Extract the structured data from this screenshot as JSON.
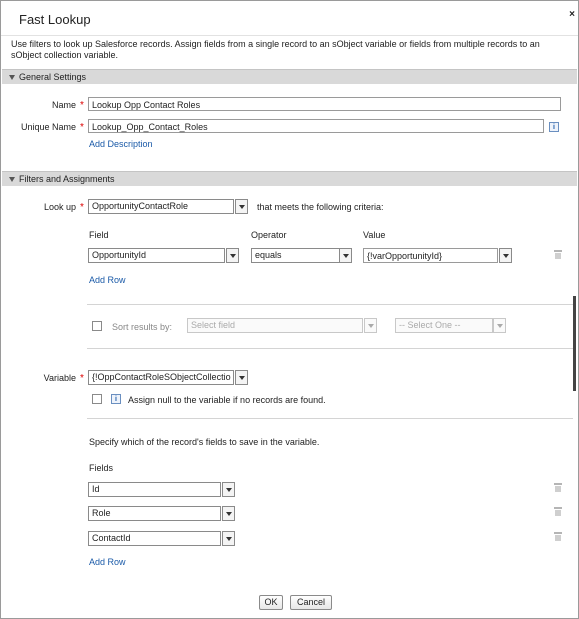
{
  "dialog": {
    "title": "Fast Lookup",
    "close": "×"
  },
  "intro": "Use filters to look up Salesforce records. Assign fields from a single record to an sObject variable or fields from multiple records to an sObject collection variable.",
  "general": {
    "header": "General Settings",
    "name_label": "Name",
    "name_value": "Lookup Opp Contact Roles",
    "unique_label": "Unique Name",
    "unique_value": "Lookup_Opp_Contact_Roles",
    "add_description": "Add Description",
    "required_mark": "*",
    "info_glyph": "i"
  },
  "filters": {
    "header": "Filters and Assignments",
    "lookup_label": "Look up",
    "lookup_value": "OpportunityContactRole",
    "criteria_text": "that meets the following criteria:",
    "col_field": "Field",
    "col_operator": "Operator",
    "col_value": "Value",
    "row_field": "OpportunityId",
    "row_operator": "equals",
    "row_value": "{!varOpportunityId}",
    "add_row": "Add Row",
    "sort_label": "Sort results by:",
    "sort_field_placeholder": "Select field",
    "sort_order_placeholder": "-- Select One --",
    "variable_label": "Variable",
    "variable_value": "{!OppContactRoleSObjectCollectio",
    "assign_null_text": "Assign null to the variable if no records are found.",
    "specify_text": "Specify which of the record's fields to save in the variable.",
    "fields_label": "Fields",
    "fields": [
      "Id",
      "Role",
      "ContactId"
    ],
    "add_row_2": "Add Row"
  },
  "footer": {
    "ok": "OK",
    "cancel": "Cancel"
  },
  "icons": [
    "close-icon",
    "collapse-triangle-icon",
    "info-icon",
    "dropdown-arrow-icon",
    "trash-icon"
  ]
}
